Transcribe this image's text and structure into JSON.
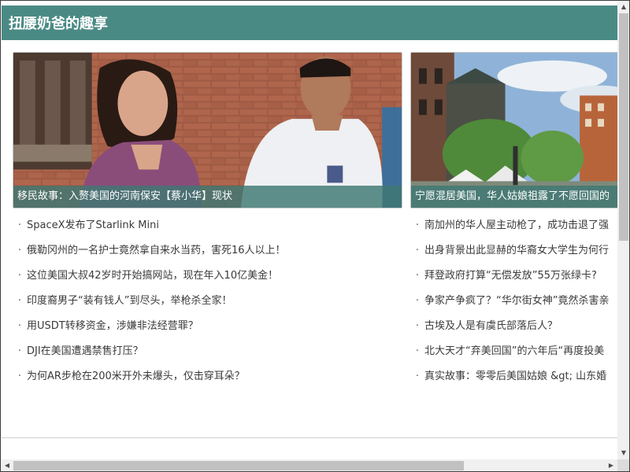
{
  "header": {
    "title": "扭腰奶爸的趣享"
  },
  "columns": [
    {
      "card": {
        "caption": "移民故事：入赘美国的河南保安【蔡小华】现状"
      },
      "items": [
        "SpaceX发布了Starlink Mini",
        "俄勒冈州的一名护士竟然拿自来水当药，害死16人以上！",
        "这位美国大叔42岁时开始搞网站，现在年入10亿美金！",
        "印度裔男子“装有钱人”到尽头，举枪杀全家！",
        "用USDT转移资金，涉嫌非法经营罪？",
        "DJI在美国遭遇禁售打压？",
        "为何AR步枪在200米开外未爆头，仅击穿耳朵？"
      ]
    },
    {
      "card": {
        "caption": "宁愿混居美国，华人姑娘祖露了不愿回国的"
      },
      "items": [
        "南加州的华人屋主动枪了，成功击退了强",
        "出身背景出此显赫的华裔女大学生为何行",
        "拜登政府打算“无偿发放”55万张绿卡?",
        "争家产争疯了？“华尔街女神”竟然杀害亲",
        "古埃及人是有虞氏部落后人？",
        "北大天才“弃美回国”的六年后“再度投美",
        "真实故事：零零后美国姑娘 &gt; 山东婚"
      ]
    }
  ],
  "bullet": "·",
  "scroll": {
    "up": "▲",
    "down": "▼",
    "left": "◀",
    "right": "▶"
  },
  "colors": {
    "header": "#4a8a85",
    "caption_bg": "#3e7873",
    "text": "#3a3a3a"
  }
}
